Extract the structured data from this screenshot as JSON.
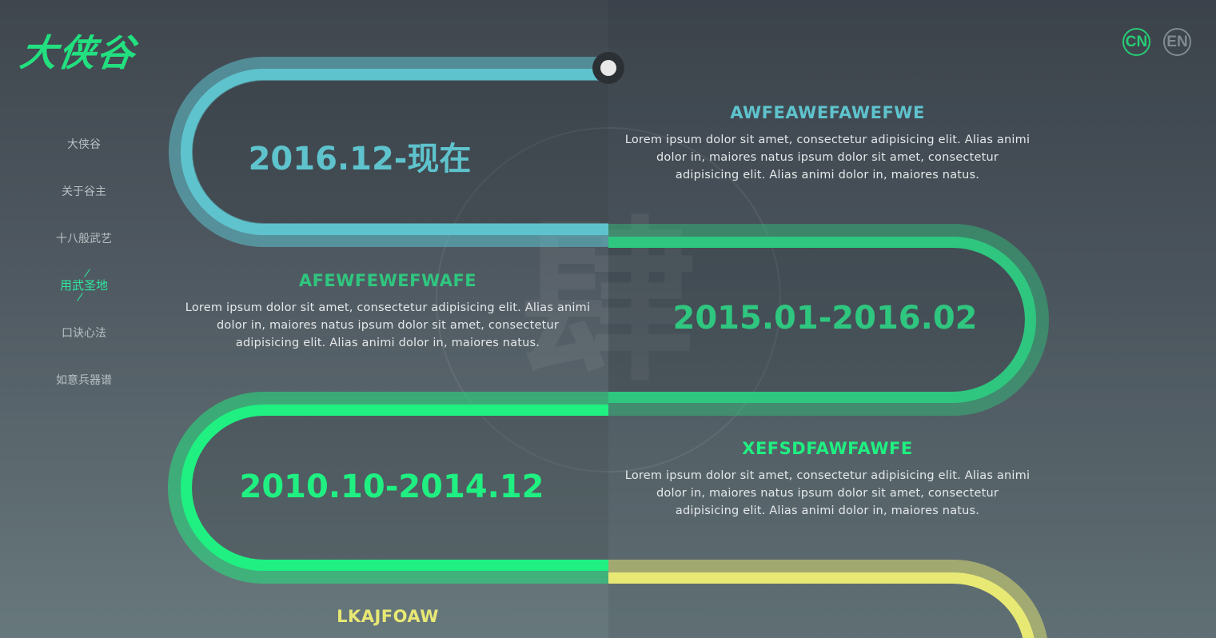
{
  "brand": {
    "logo_text": "大侠谷"
  },
  "nav": {
    "items": [
      {
        "label": "大侠谷"
      },
      {
        "label": "关于谷主"
      },
      {
        "label": "十八般武艺"
      },
      {
        "label": "用武圣地",
        "active": true
      },
      {
        "label": "口诀心法"
      },
      {
        "label": "如意兵器谱"
      }
    ]
  },
  "lang": {
    "cn": "CN",
    "en": "EN",
    "active": "CN"
  },
  "watermark": {
    "char": "肆"
  },
  "timeline": [
    {
      "date": "2016.12-现在",
      "title": "AWFEAWEFAWEFWE",
      "desc": "Lorem ipsum dolor sit amet, consectetur adipisicing elit. Alias animi dolor in, maiores natus ipsum dolor sit amet, consectetur adipisicing elit. Alias animi dolor in, maiores natus.",
      "color": "#5ec3cd"
    },
    {
      "date": "2015.01-2016.02",
      "title": "AFEWFEWEFWAFE",
      "desc": "Lorem ipsum dolor sit amet, consectetur adipisicing elit. Alias animi dolor in, maiores natus ipsum dolor sit amet, consectetur adipisicing elit. Alias animi dolor in, maiores natus.",
      "color": "#2fc67f"
    },
    {
      "date": "2010.10-2014.12",
      "title": "XEFSDFAWFAWFE",
      "desc": "Lorem ipsum dolor sit amet, consectetur adipisicing elit. Alias animi dolor in, maiores natus ipsum dolor sit amet, consectetur adipisicing elit. Alias animi dolor in, maiores natus.",
      "color": "#1ff081"
    },
    {
      "title": "LKAJFOAW",
      "color": "#e8e874"
    }
  ]
}
